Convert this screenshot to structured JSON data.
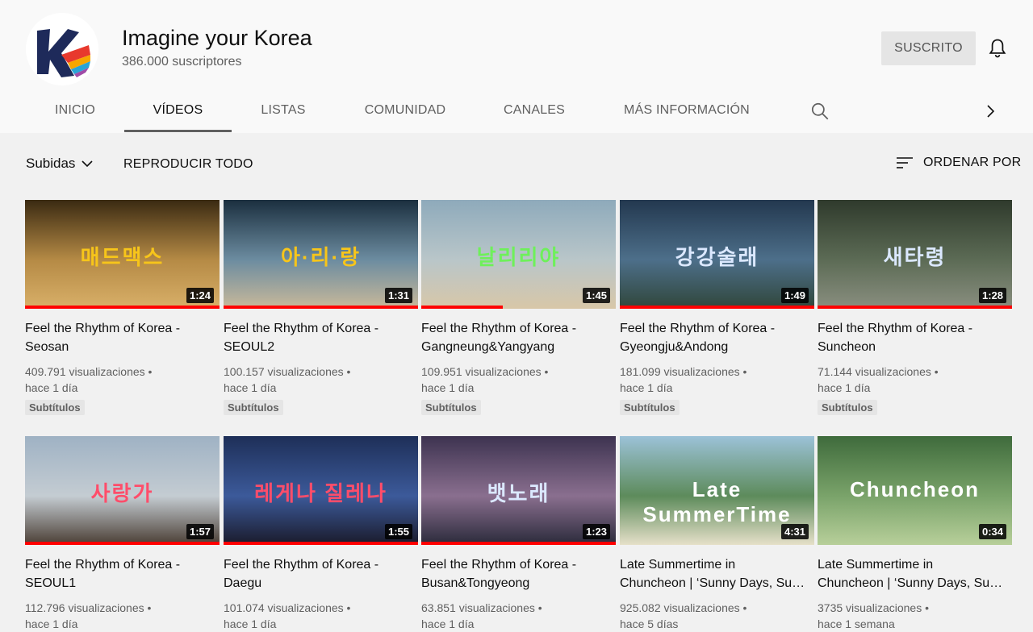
{
  "channel": {
    "name": "Imagine your Korea",
    "subscribers": "386.000 suscriptores",
    "subscribe_label": "SUSCRITO"
  },
  "tabs": [
    {
      "label": "INICIO"
    },
    {
      "label": "VÍDEOS",
      "active": true
    },
    {
      "label": "LISTAS"
    },
    {
      "label": "COMUNIDAD"
    },
    {
      "label": "CANALES"
    },
    {
      "label": "MÁS INFORMACIÓN"
    }
  ],
  "toolbar": {
    "filter_label": "Subidas",
    "play_all_label": "REPRODUCIR TODO",
    "sort_label": "ORDENAR POR"
  },
  "videos": [
    {
      "title_line1": "Feel the Rhythm of Korea -",
      "title_line2": "Seosan",
      "views": "409.791 visualizaciones •",
      "age": "hace 1 día",
      "badge": "Subtítulos",
      "duration": "1:24",
      "overlay": "매드맥스",
      "progress": 1.0,
      "colors": [
        "#3a2a12",
        "#b58a45",
        "#d9b069"
      ]
    },
    {
      "title_line1": "Feel the Rhythm of Korea -",
      "title_line2": "SEOUL2",
      "views": "100.157 visualizaciones •",
      "age": "hace 1 día",
      "badge": "Subtítulos",
      "duration": "1:31",
      "overlay": "아·리·랑",
      "progress": 1.0,
      "colors": [
        "#1b2f3f",
        "#6c8ca0",
        "#c9b99a"
      ]
    },
    {
      "title_line1": "Feel the Rhythm of Korea -",
      "title_line2": "Gangneung&Yangyang",
      "views": "109.951 visualizaciones •",
      "age": "hace 1 día",
      "badge": "Subtítulos",
      "duration": "1:45",
      "overlay": "날리리야",
      "progress": 0.42,
      "colors": [
        "#8eaabb",
        "#b9c6c9",
        "#d8c7a8"
      ]
    },
    {
      "title_line1": "Feel the Rhythm of Korea -",
      "title_line2": "Gyeongju&Andong",
      "views": "181.099 visualizaciones •",
      "age": "hace 1 día",
      "badge": "Subtítulos",
      "duration": "1:49",
      "overlay": "강강술래",
      "progress": 1.0,
      "colors": [
        "#23384f",
        "#4d6f8a",
        "#30463a"
      ]
    },
    {
      "title_line1": "Feel the Rhythm of Korea -",
      "title_line2": "Suncheon",
      "views": "71.144 visualizaciones •",
      "age": "hace 1 día",
      "badge": "Subtítulos",
      "duration": "1:28",
      "overlay": "새타령",
      "progress": 1.0,
      "colors": [
        "#2f3a2c",
        "#5c6b55",
        "#8a8f80"
      ]
    },
    {
      "title_line1": "Feel the Rhythm of Korea -",
      "title_line2": "SEOUL1",
      "views": "112.796 visualizaciones •",
      "age": "hace 1 día",
      "badge": "",
      "duration": "1:57",
      "overlay": "사랑가",
      "progress": 1.0,
      "colors": [
        "#9fb2c4",
        "#c4ccd2",
        "#4a3d33"
      ]
    },
    {
      "title_line1": "Feel the Rhythm of Korea -",
      "title_line2": "Daegu",
      "views": "101.074 visualizaciones •",
      "age": "hace 1 día",
      "badge": "",
      "duration": "1:55",
      "overlay": "레게나 질레나",
      "progress": 1.0,
      "colors": [
        "#1e2f58",
        "#3c5a9a",
        "#1a1a2a"
      ]
    },
    {
      "title_line1": "Feel the Rhythm of Korea -",
      "title_line2": "Busan&Tongyeong",
      "views": "63.851 visualizaciones •",
      "age": "hace 1 día",
      "badge": "",
      "duration": "1:23",
      "overlay": "뱃노래",
      "progress": 1.0,
      "colors": [
        "#3d3350",
        "#8a6f8f",
        "#2a2a3a"
      ]
    },
    {
      "title_line1": "Late Summertime in",
      "title_line2": "Chuncheon  | ‘Sunny Days, Summer Nights’",
      "views": "925.082 visualizaciones •",
      "age": "hace 5 días",
      "badge": "",
      "duration": "4:31",
      "overlay": "Late SummerTime",
      "progress": 0,
      "colors": [
        "#9cc2d8",
        "#5d8b5b",
        "#e6e0c9"
      ]
    },
    {
      "title_line1": "Late Summertime in",
      "title_line2": "Chuncheon | ‘Sunny Days, Summer Nights’",
      "views": "3735 visualizaciones •",
      "age": "hace 1 semana",
      "badge": "",
      "duration": "0:34",
      "overlay": "Chuncheon",
      "progress": 0,
      "colors": [
        "#3f6b3c",
        "#7aa36a",
        "#b7cf9a"
      ]
    }
  ]
}
